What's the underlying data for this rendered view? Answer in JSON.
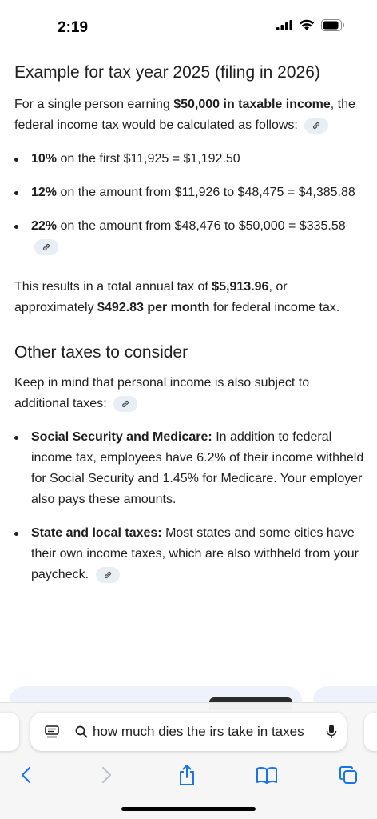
{
  "status": {
    "time": "2:19"
  },
  "section1": {
    "heading": "Example for tax year 2025 (filing in 2026)",
    "intro_a": "For a single person earning ",
    "intro_b": "$50,000 in taxable income",
    "intro_c": ", the federal income tax would be calculated as follows:",
    "bullets": [
      {
        "bold": "10%",
        "text": " on the first $11,925 = $1,192.50"
      },
      {
        "bold": "12%",
        "text": " on the amount from $11,926 to $48,475 = $4,385.88"
      },
      {
        "bold": "22%",
        "text": " on the amount from $48,476 to $50,000 = $335.58"
      }
    ],
    "result_a": "This results in a total annual tax of ",
    "result_b": "$5,913.96",
    "result_c": ", or approximately ",
    "result_d": "$492.83 per month",
    "result_e": " for federal income tax."
  },
  "section2": {
    "heading": "Other taxes to consider",
    "intro": "Keep in mind that personal income is also subject to additional taxes:",
    "bullets": [
      {
        "bold": "Social Security and Medicare:",
        "text": " In addition to federal income tax, employees have 6.2% of their income withheld for Social Security and 1.45% for Medicare. Your employer also pays these amounts."
      },
      {
        "bold": "State and local taxes:",
        "text": " Most states and some cities have their own income taxes, which are also withheld from your paycheck."
      }
    ]
  },
  "browser": {
    "url_text": "how much dies the irs take in taxes",
    "icons": [
      "reader-icon",
      "search-icon",
      "microphone-icon",
      "back-icon",
      "forward-icon",
      "share-icon",
      "bookmarks-icon",
      "tabs-icon"
    ]
  },
  "colors": {
    "accent": "#1a73e8",
    "chip_bg": "#e8eef6",
    "card_bg": "#eef3fb"
  }
}
